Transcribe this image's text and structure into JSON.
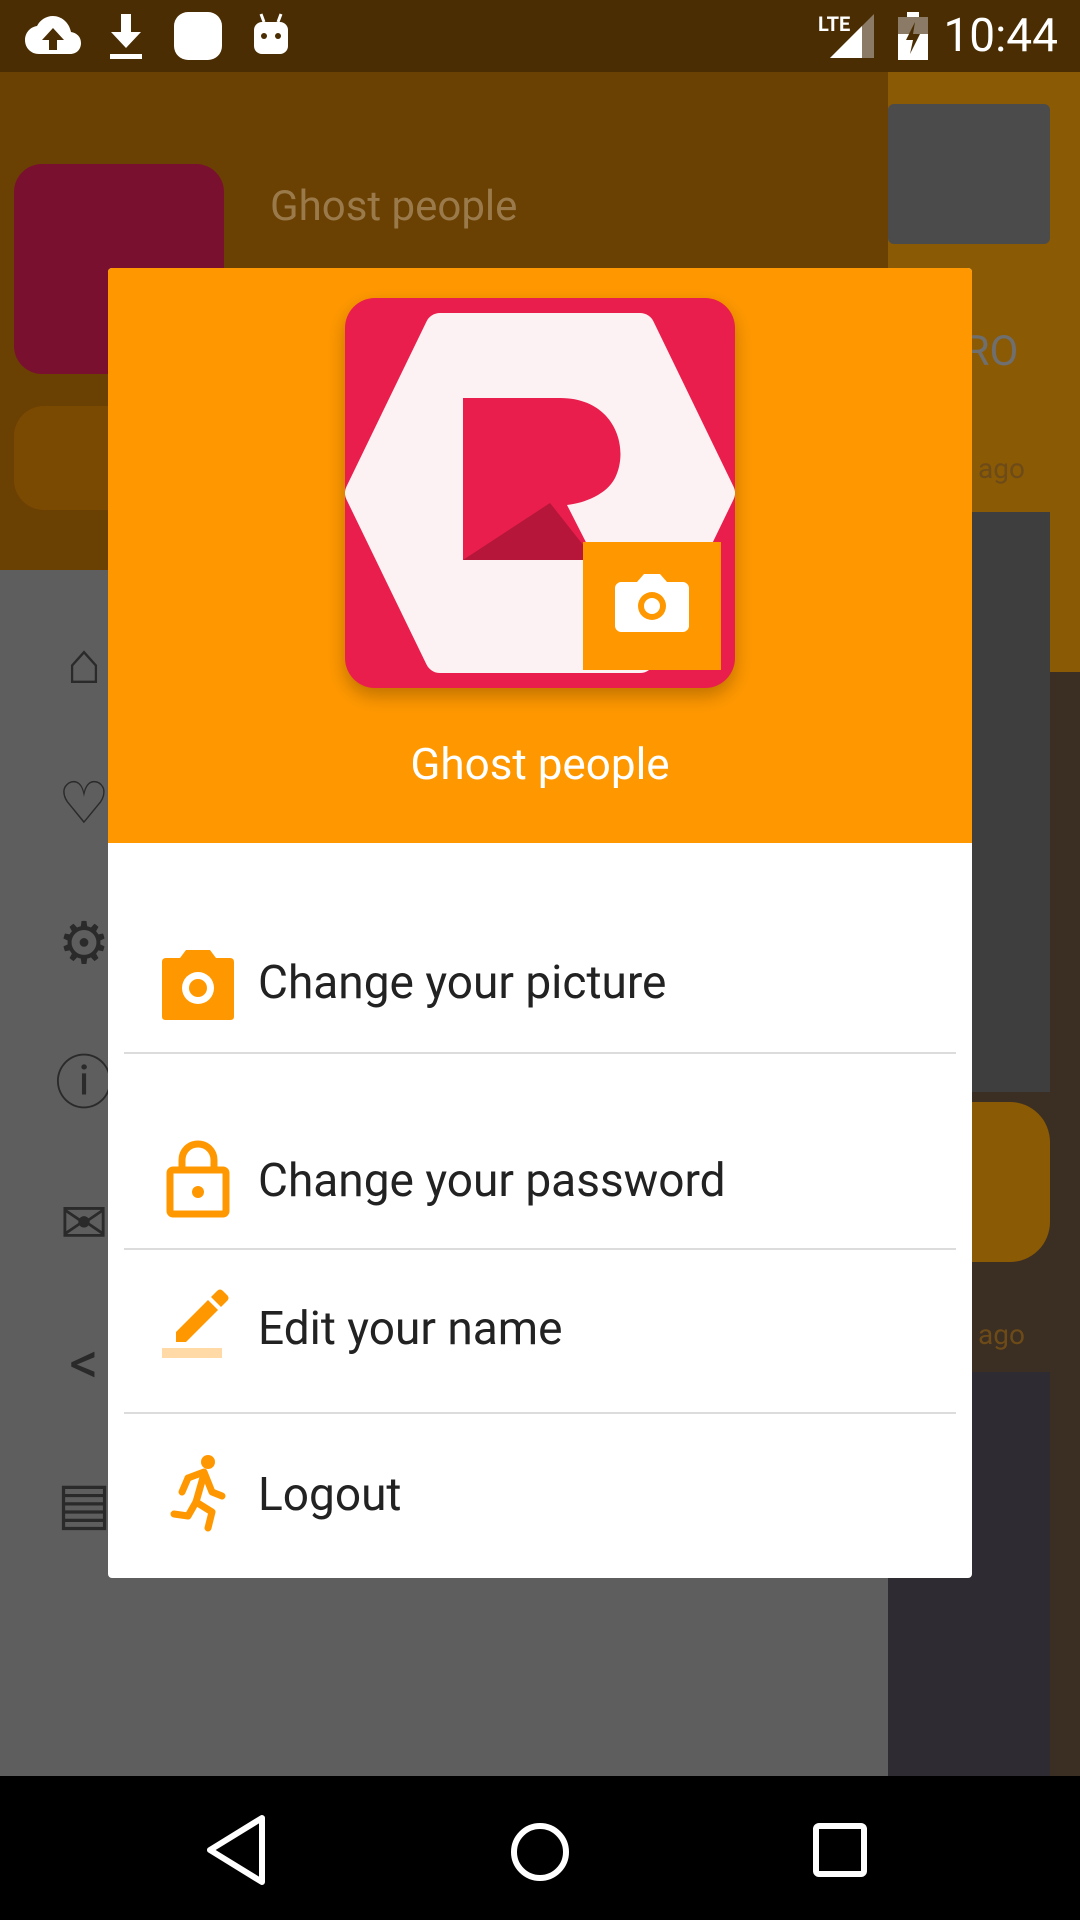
{
  "status_bar": {
    "time": "10:44",
    "network": "LTE",
    "icons": [
      "cloud-upload-icon",
      "download-icon",
      "app-icon",
      "android-icon"
    ]
  },
  "background": {
    "drawer_user_name": "Ghost people",
    "tab_fragment": "ECTRO",
    "time_ago_1": "ago",
    "time_ago_2": "ago"
  },
  "dialog": {
    "title": "Ghost people",
    "menu": [
      {
        "label": "Change your picture",
        "icon": "camera-icon"
      },
      {
        "label": "Change your password",
        "icon": "lock-icon"
      },
      {
        "label": "Edit your name",
        "icon": "pencil-icon"
      },
      {
        "label": "Logout",
        "icon": "run-icon"
      }
    ]
  },
  "colors": {
    "accent": "#ff9800",
    "brand": "#e91e4c"
  },
  "nav_bar": {
    "buttons": [
      "back-icon",
      "home-icon",
      "recents-icon"
    ]
  }
}
